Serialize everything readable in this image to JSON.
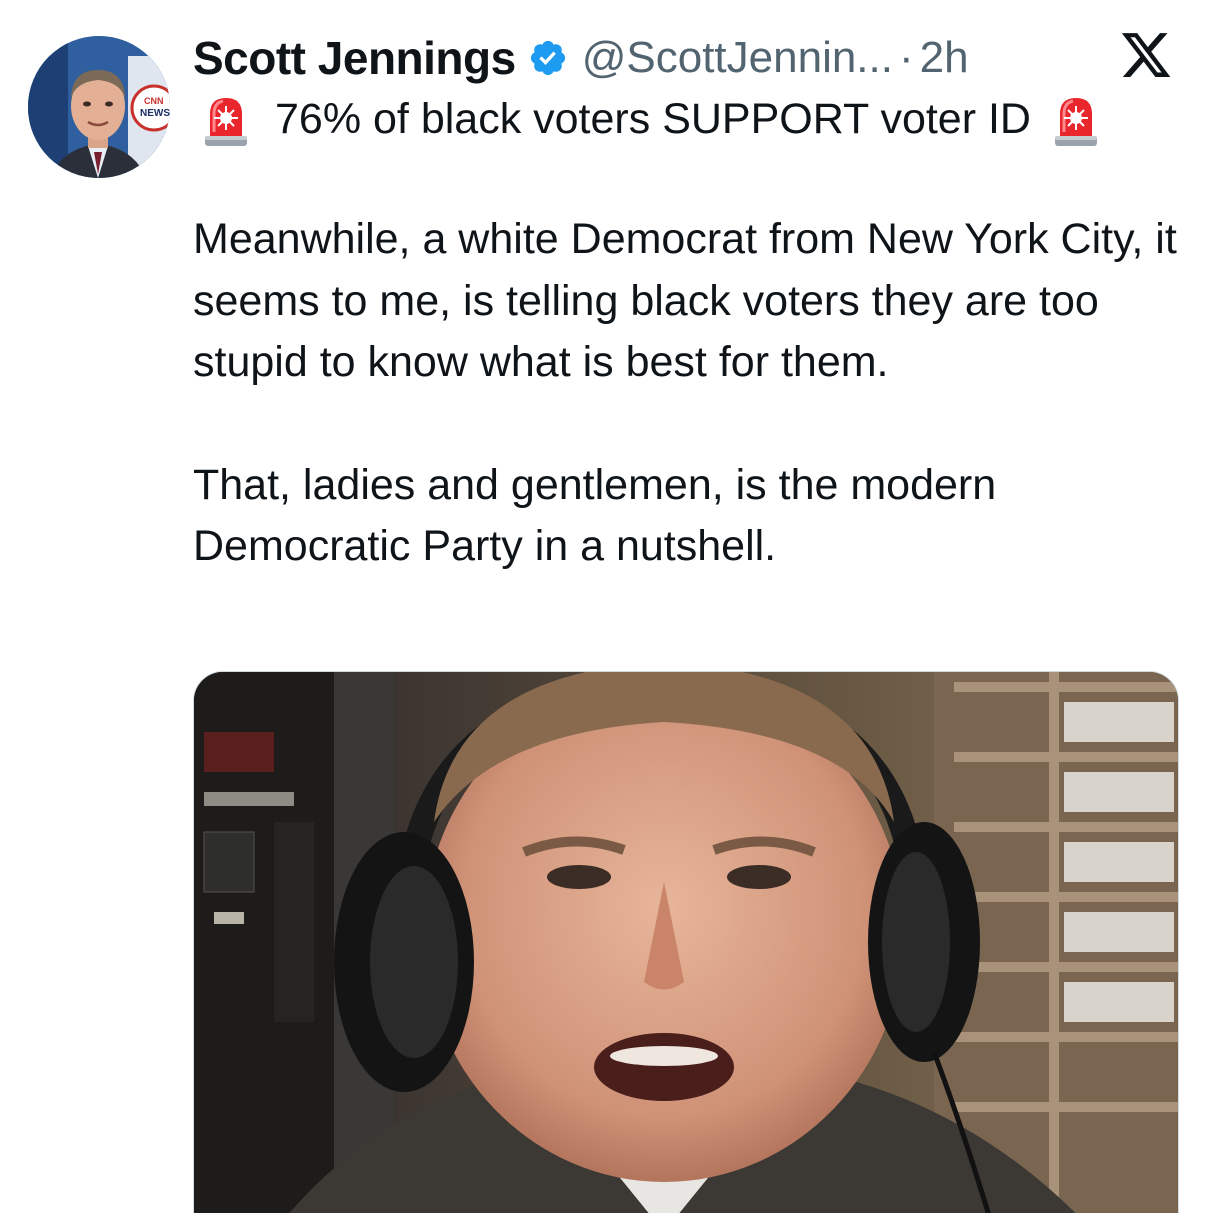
{
  "author": {
    "display_name": "Scott Jennings",
    "handle": "@ScottJennin...",
    "separator": "·",
    "timestamp": "2h",
    "verified_badge_color": "#1d9bf0",
    "avatar_badge_text": "NEWS"
  },
  "platform": {
    "logo_icon": "x-logo-icon"
  },
  "tweet": {
    "first_line": "76% of black voters SUPPORT voter ID",
    "first_line_icons": [
      "police-car-light-icon",
      "police-car-light-icon"
    ],
    "paragraph_1": "Meanwhile, a white Democrat from New York City, it seems to me, is telling black voters they are too stupid to know what is best for them.",
    "paragraph_2": "That, ladies and gentlemen, is the modern Democratic Party in a nutshell."
  },
  "media": {
    "type": "photo",
    "subject": "man-with-headphones-in-radio-studio"
  },
  "colors": {
    "text_primary": "#0f1419",
    "text_secondary": "#536471",
    "verified_blue": "#1d9bf0",
    "siren_red": "#e8262c"
  }
}
